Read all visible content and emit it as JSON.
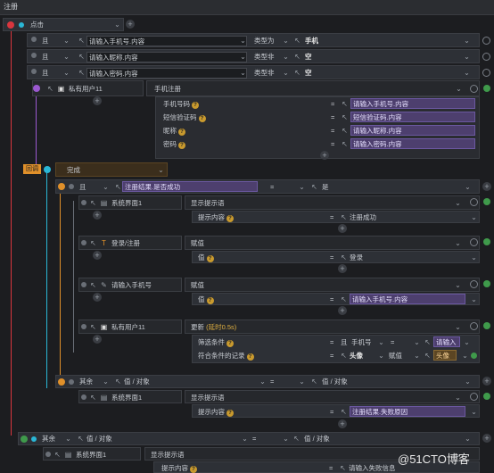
{
  "window": {
    "title": "注册"
  },
  "colors": {
    "accent_red": "#d9363e",
    "accent_cyan": "#2ab7d6",
    "accent_orange": "#e0902a",
    "accent_purple": "#9b59d0",
    "accent_green": "#3f9a4b"
  },
  "root": {
    "event": "点击"
  },
  "conditions": [
    {
      "logic": "且",
      "field": "请输入手机号.内容",
      "op": "类型为",
      "value": "手机"
    },
    {
      "logic": "且",
      "field": "请输入昵称.内容",
      "op": "类型非",
      "value": "空"
    },
    {
      "logic": "且",
      "field": "请输入密码.内容",
      "op": "类型非",
      "value": "空"
    }
  ],
  "private_user": {
    "name": "私有用户11",
    "action": "手机注册",
    "params": [
      {
        "label": "手机号码",
        "value": "请输入手机号.内容"
      },
      {
        "label": "短信验证码",
        "value": "短信验证码.内容"
      },
      {
        "label": "昵称",
        "value": "请输入昵称.内容"
      },
      {
        "label": "密码",
        "value": "请输入密码.内容"
      }
    ]
  },
  "callback": {
    "badge": "回调",
    "state": "完成"
  },
  "sub_condition": {
    "logic": "且",
    "field": "注册结果.是否成功",
    "op": "=",
    "value": "是"
  },
  "actions": [
    {
      "target": "系统界面1",
      "action": "显示提示语",
      "param_label": "提示内容",
      "param_value": "注册成功"
    },
    {
      "target": "登录/注册",
      "action": "赋值",
      "param_label": "值",
      "param_value": "登录"
    },
    {
      "target": "请输入手机号",
      "action": "赋值",
      "param_label": "值",
      "param_value": "请输入手机号.内容"
    },
    {
      "target": "私有用户11",
      "action": "更新",
      "delay": "(延时0.5s)"
    }
  ],
  "update_params": {
    "filter_label": "筛选条件",
    "filter_logic": "且",
    "filter_field": "手机号",
    "filter_op": "=",
    "filter_value": "请输入",
    "record_label": "符合条件的记录",
    "record_field": "头像",
    "record_op": "赋值",
    "record_value": "头像"
  },
  "else_inner": {
    "logic": "其余",
    "field": "值 / 对象",
    "op": "=",
    "value": "值 / 对象",
    "target": "系统界面1",
    "action": "显示提示语",
    "param_label": "提示内容",
    "param_value": "注册结果.失败原因"
  },
  "else_outer": {
    "logic": "其余",
    "field": "值 / 对象",
    "op": "=",
    "value": "值 / 对象",
    "target": "系统界面1",
    "action": "显示提示语",
    "param_label": "提示内容",
    "param_value": "请输入失败信息"
  },
  "watermark": "@51CTO博客"
}
